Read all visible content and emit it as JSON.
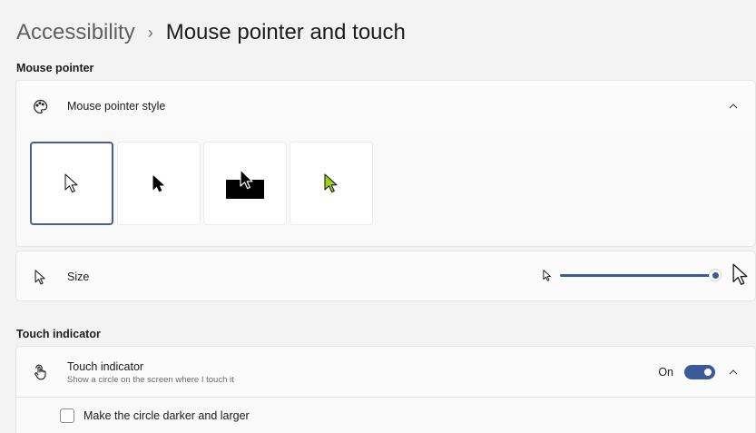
{
  "breadcrumb": {
    "parent": "Accessibility",
    "separator": "›",
    "current": "Mouse pointer and touch"
  },
  "sections": {
    "mouse_pointer": "Mouse pointer",
    "touch_indicator": "Touch indicator"
  },
  "mouse_pointer_style": {
    "label": "Mouse pointer style",
    "expanded": true,
    "options": [
      {
        "name": "white",
        "selected": true
      },
      {
        "name": "black",
        "selected": false
      },
      {
        "name": "inverted",
        "selected": false
      },
      {
        "name": "custom",
        "color": "#9bd21b",
        "selected": false
      }
    ]
  },
  "size": {
    "label": "Size",
    "value_fraction": 1.0
  },
  "touch": {
    "label": "Touch indicator",
    "description": "Show a circle on the screen where I touch it",
    "state_label": "On",
    "enabled": true,
    "checkbox_label": "Make the circle darker and larger",
    "checkbox_checked": false
  },
  "colors": {
    "accent": "#3b5a9a",
    "selected_border": "#4a5d8e",
    "custom_pointer": "#9bd21b"
  },
  "icons": {
    "pointer_style": "palette-icon",
    "size": "pointer-arrow-icon",
    "touch": "touch-hand-icon",
    "collapse": "chevron-up-icon"
  }
}
